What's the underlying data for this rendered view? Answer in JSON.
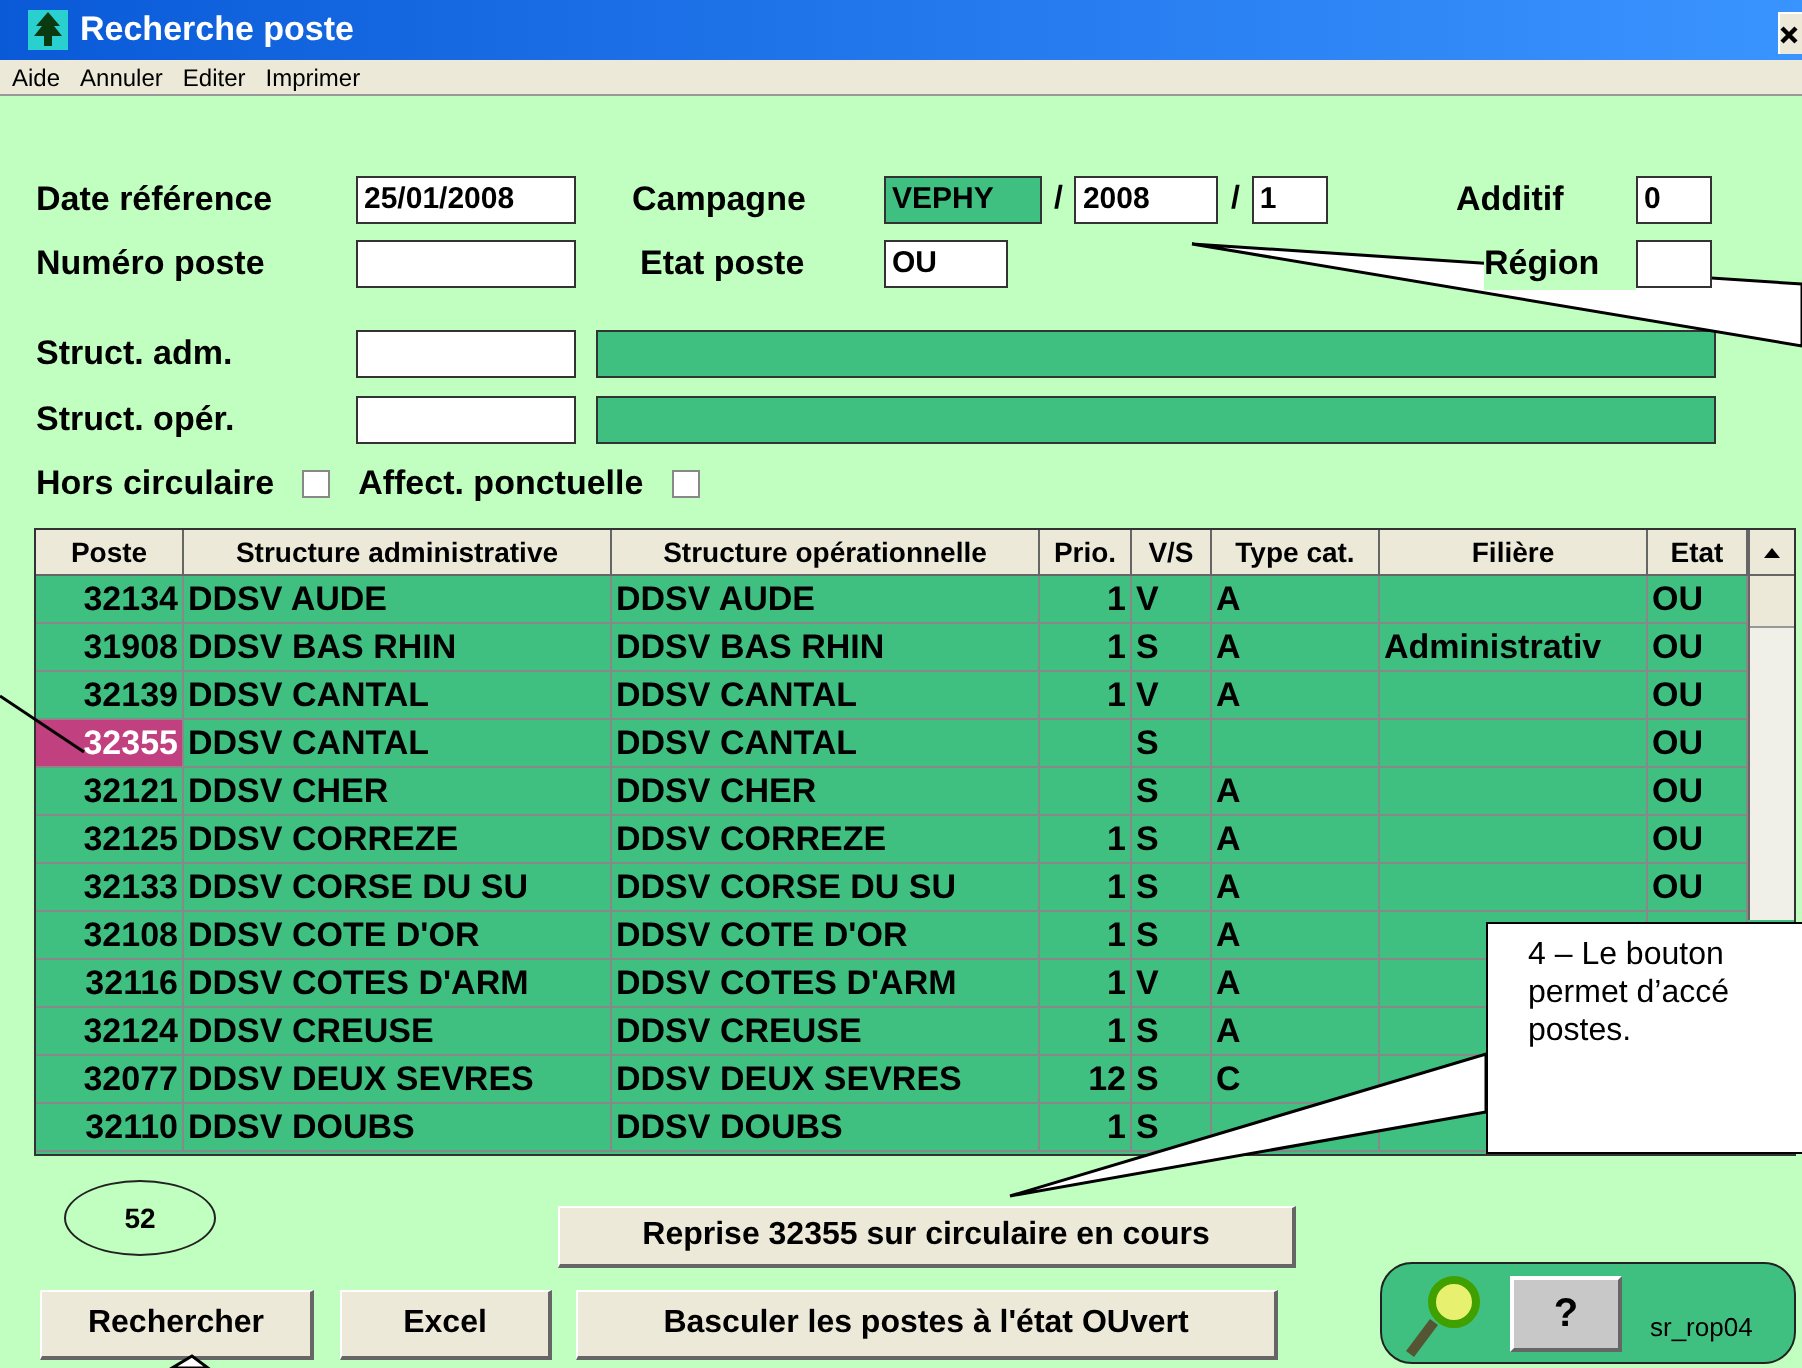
{
  "window": {
    "title": "Recherche poste"
  },
  "menu": [
    "Aide",
    "Annuler",
    "Editer",
    "Imprimer"
  ],
  "form": {
    "date_reference": {
      "label": "Date référence",
      "value": "25/01/2008"
    },
    "campagne": {
      "label": "Campagne",
      "code": "VEPHY",
      "separator_1": "/",
      "year": "2008",
      "separator_2": "/",
      "number": "1"
    },
    "additif": {
      "label": "Additif",
      "value": "0"
    },
    "numero_poste": {
      "label": "Numéro poste"
    },
    "etat_poste": {
      "label": "Etat poste",
      "value": "OU"
    },
    "region": {
      "label": "Région"
    },
    "struct_adm": {
      "label": "Struct. adm."
    },
    "struct_oper": {
      "label": "Struct. opér."
    },
    "checkboxes": [
      {
        "label": "Hors circulaire",
        "checked": false
      },
      {
        "label": "Affect. ponctuelle",
        "checked": false
      }
    ]
  },
  "table": {
    "columns": [
      "Poste",
      "Structure administrative",
      "Structure opérationnelle",
      "Prio.",
      "V/S",
      "Type cat.",
      "Filière",
      "Etat"
    ],
    "rows": [
      {
        "selected": false,
        "cells": [
          "32134",
          "DDSV AUDE",
          "DDSV AUDE",
          "1",
          "V",
          "A",
          "",
          "OU"
        ]
      },
      {
        "selected": false,
        "cells": [
          "31908",
          "DDSV BAS RHIN",
          "DDSV BAS RHIN",
          "1",
          "S",
          "A",
          "Administrativ",
          "OU"
        ]
      },
      {
        "selected": false,
        "cells": [
          "32139",
          "DDSV CANTAL",
          "DDSV CANTAL",
          "1",
          "V",
          "A",
          "",
          "OU"
        ]
      },
      {
        "selected": true,
        "cells": [
          "32355",
          "DDSV CANTAL",
          "DDSV CANTAL",
          "",
          "S",
          "",
          "",
          "OU"
        ]
      },
      {
        "selected": false,
        "cells": [
          "32121",
          "DDSV CHER",
          "DDSV CHER",
          "",
          "S",
          "A",
          "",
          "OU"
        ]
      },
      {
        "selected": false,
        "cells": [
          "32125",
          "DDSV CORREZE",
          "DDSV CORREZE",
          "1",
          "S",
          "A",
          "",
          "OU"
        ]
      },
      {
        "selected": false,
        "cells": [
          "32133",
          "DDSV CORSE DU SU",
          "DDSV CORSE DU SU",
          "1",
          "S",
          "A",
          "",
          "OU"
        ]
      },
      {
        "selected": false,
        "cells": [
          "32108",
          "DDSV COTE D'OR",
          "DDSV COTE D'OR",
          "1",
          "S",
          "A",
          "",
          ""
        ]
      },
      {
        "selected": false,
        "cells": [
          "32116",
          "DDSV COTES D'ARM",
          "DDSV COTES D'ARM",
          "1",
          "V",
          "A",
          "",
          ""
        ]
      },
      {
        "selected": false,
        "cells": [
          "32124",
          "DDSV CREUSE",
          "DDSV CREUSE",
          "1",
          "S",
          "A",
          "",
          ""
        ]
      },
      {
        "selected": false,
        "cells": [
          "32077",
          "DDSV DEUX SEVRES",
          "DDSV DEUX SEVRES",
          "12",
          "S",
          "C",
          "",
          ""
        ]
      },
      {
        "selected": false,
        "cells": [
          "32110",
          "DDSV DOUBS",
          "DDSV DOUBS",
          "1",
          "S",
          "",
          "",
          ""
        ]
      }
    ]
  },
  "count": "52",
  "buttons": {
    "reprise": "Reprise 32355 sur circulaire en cours",
    "rechercher": "Rechercher",
    "excel": "Excel",
    "basculer": "Basculer les postes à l'état OUvert",
    "help": "?"
  },
  "screen_code": "sr_rop04",
  "callout": {
    "lines": [
      "4 – Le bouton",
      "permet d’accé",
      "postes."
    ]
  }
}
